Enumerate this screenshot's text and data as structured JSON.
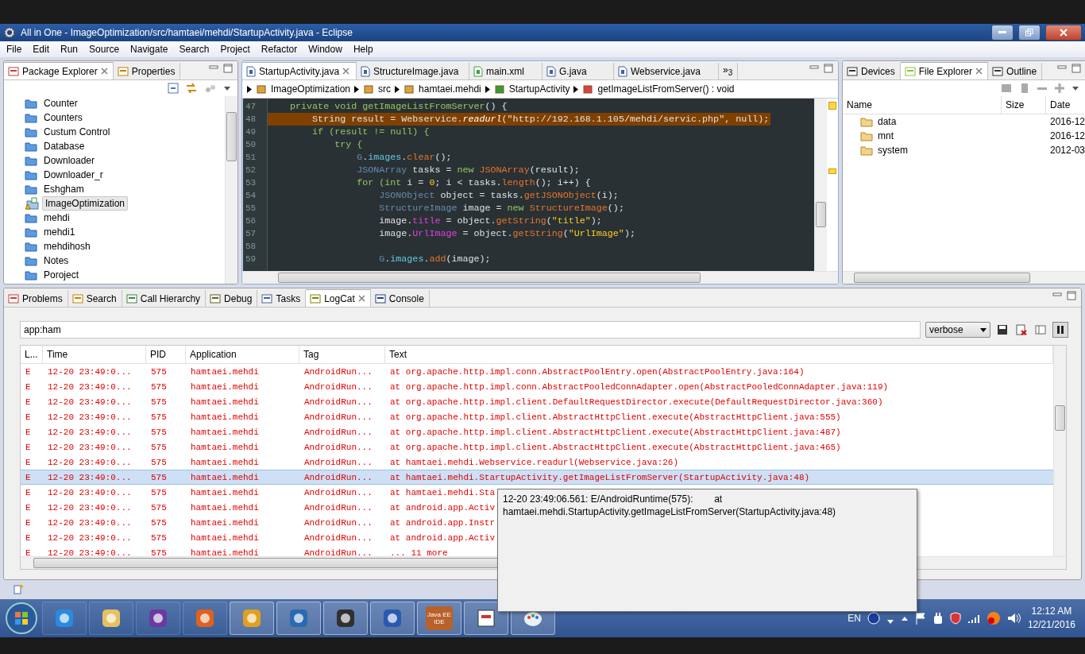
{
  "window": {
    "title": "All in One - ImageOptimization/src/hamtaei/mehdi/StartupActivity.java - Eclipse"
  },
  "menu": [
    "File",
    "Edit",
    "Run",
    "Source",
    "Navigate",
    "Search",
    "Project",
    "Refactor",
    "Window",
    "Help"
  ],
  "package_explorer": {
    "tabs": [
      {
        "label": "Package Explorer",
        "selected": true
      },
      {
        "label": "Properties",
        "selected": false
      }
    ],
    "items": [
      {
        "label": "Counter",
        "kind": "closed",
        "selected": false
      },
      {
        "label": "Counters",
        "kind": "closed",
        "selected": false
      },
      {
        "label": "Custum Control",
        "kind": "closed",
        "selected": false
      },
      {
        "label": "Database",
        "kind": "closed",
        "selected": false
      },
      {
        "label": "Downloader",
        "kind": "closed",
        "selected": false
      },
      {
        "label": "Downloader_r",
        "kind": "closed",
        "selected": false
      },
      {
        "label": "Eshgham",
        "kind": "closed",
        "selected": false
      },
      {
        "label": "ImageOptimization",
        "kind": "open",
        "selected": true
      },
      {
        "label": "mehdi",
        "kind": "closed",
        "selected": false
      },
      {
        "label": "mehdi1",
        "kind": "closed",
        "selected": false
      },
      {
        "label": "mehdihosh",
        "kind": "closed",
        "selected": false
      },
      {
        "label": "Notes",
        "kind": "closed",
        "selected": false
      },
      {
        "label": "Poroject",
        "kind": "closed",
        "selected": false
      }
    ]
  },
  "editor": {
    "tabs": [
      {
        "label": "StartupActivity.java",
        "selected": true
      },
      {
        "label": "StructureImage.java",
        "selected": false
      },
      {
        "label": "main.xml",
        "selected": false
      },
      {
        "label": "G.java",
        "selected": false
      },
      {
        "label": "Webservice.java",
        "selected": false
      }
    ],
    "overflow": "»$_{3}$",
    "breadcrumb": [
      "ImageOptimization",
      "src",
      "hamtaei.mehdi",
      "StartupActivity",
      "getImageListFromServer() : void"
    ],
    "lines": [
      {
        "number": "47",
        "highlighted": false,
        "tokens": [
          {
            "kind": "kw",
            "text": "    private void getImageListFromServer"
          },
          {
            "kind": "plain",
            "text": "() {"
          }
        ]
      },
      {
        "number": "48",
        "highlighted": true,
        "tokens": [
          {
            "kind": "plain",
            "text": "        String result = Webservice."
          },
          {
            "kind": "italic",
            "text": "readurl"
          },
          {
            "kind": "plain",
            "text": "(\"http://192.168.1.105/mehdi/servic.php\", null);"
          }
        ]
      },
      {
        "number": "49",
        "highlighted": false,
        "tokens": [
          {
            "kind": "kw",
            "text": "        if (result != null) {"
          }
        ]
      },
      {
        "number": "50",
        "highlighted": false,
        "tokens": [
          {
            "kind": "kw",
            "text": "            try {"
          }
        ]
      },
      {
        "number": "51",
        "highlighted": false,
        "tokens": [
          {
            "kind": "type",
            "text": "                G"
          },
          {
            "kind": "plain",
            "text": "."
          },
          {
            "kind": "field",
            "text": "images"
          },
          {
            "kind": "plain",
            "text": "."
          },
          {
            "kind": "method",
            "text": "clear"
          },
          {
            "kind": "plain",
            "text": "();"
          }
        ]
      },
      {
        "number": "52",
        "highlighted": false,
        "tokens": [
          {
            "kind": "type",
            "text": "                JSONArray"
          },
          {
            "kind": "plain",
            "text": " tasks = "
          },
          {
            "kind": "kw",
            "text": "new"
          },
          {
            "kind": "method",
            "text": " JSONArray"
          },
          {
            "kind": "plain",
            "text": "(result);"
          }
        ]
      },
      {
        "number": "53",
        "highlighted": false,
        "tokens": [
          {
            "kind": "kw",
            "text": "                for (int"
          },
          {
            "kind": "plain",
            "text": " i = "
          },
          {
            "kind": "num",
            "text": "0"
          },
          {
            "kind": "plain",
            "text": "; i < tasks."
          },
          {
            "kind": "method",
            "text": "length"
          },
          {
            "kind": "plain",
            "text": "(); i++) {"
          }
        ]
      },
      {
        "number": "54",
        "highlighted": false,
        "tokens": [
          {
            "kind": "type",
            "text": "                    JSONObject"
          },
          {
            "kind": "plain",
            "text": " object = tasks."
          },
          {
            "kind": "method",
            "text": "getJSONObject"
          },
          {
            "kind": "plain",
            "text": "(i);"
          }
        ]
      },
      {
        "number": "55",
        "highlighted": false,
        "tokens": [
          {
            "kind": "type",
            "text": "                    StructureImage"
          },
          {
            "kind": "plain",
            "text": " image = "
          },
          {
            "kind": "kw",
            "text": "new"
          },
          {
            "kind": "method",
            "text": " StructureImage"
          },
          {
            "kind": "plain",
            "text": "();"
          }
        ]
      },
      {
        "number": "56",
        "highlighted": false,
        "tokens": [
          {
            "kind": "plain",
            "text": "                    image."
          },
          {
            "kind": "member",
            "text": "title"
          },
          {
            "kind": "plain",
            "text": " = object."
          },
          {
            "kind": "method",
            "text": "getString"
          },
          {
            "kind": "plain",
            "text": "("
          },
          {
            "kind": "string",
            "text": "\"title\""
          },
          {
            "kind": "plain",
            "text": ");"
          }
        ]
      },
      {
        "number": "57",
        "highlighted": false,
        "tokens": [
          {
            "kind": "plain",
            "text": "                    image."
          },
          {
            "kind": "member",
            "text": "UrlImage"
          },
          {
            "kind": "plain",
            "text": " = object."
          },
          {
            "kind": "method",
            "text": "getString"
          },
          {
            "kind": "plain",
            "text": "("
          },
          {
            "kind": "string",
            "text": "\"UrlImage\""
          },
          {
            "kind": "plain",
            "text": ");"
          }
        ]
      },
      {
        "number": "58"
      },
      {
        "number": "59",
        "highlighted": false,
        "tokens": [
          {
            "kind": "type",
            "text": "                    G"
          },
          {
            "kind": "plain",
            "text": "."
          },
          {
            "kind": "field",
            "text": "images"
          },
          {
            "kind": "plain",
            "text": "."
          },
          {
            "kind": "method",
            "text": "add"
          },
          {
            "kind": "plain",
            "text": "(image);"
          }
        ]
      }
    ]
  },
  "file_explorer": {
    "tabs": [
      {
        "label": "Devices",
        "selected": false
      },
      {
        "label": "File Explorer",
        "selected": true
      },
      {
        "label": "Outline",
        "selected": false
      }
    ],
    "columns": [
      "Name",
      "Size",
      "Date"
    ],
    "rows": [
      {
        "name": "data",
        "date": "2016-12"
      },
      {
        "name": "mnt",
        "date": "2016-12"
      },
      {
        "name": "system",
        "date": "2012-03"
      }
    ]
  },
  "bottom": {
    "tabs": [
      {
        "label": "Problems",
        "selected": false
      },
      {
        "label": "Search",
        "selected": false
      },
      {
        "label": "Call Hierarchy",
        "selected": false
      },
      {
        "label": "Debug",
        "selected": false
      },
      {
        "label": "Tasks",
        "selected": false
      },
      {
        "label": "LogCat",
        "selected": true
      },
      {
        "label": "Console",
        "selected": false
      }
    ],
    "filter": "app:ham",
    "log_level": "verbose",
    "columns": [
      "L...",
      "Time",
      "PID",
      "Application",
      "Tag",
      "Text"
    ],
    "rows": [
      {
        "level": "E",
        "time": "12-20 23:49:0...",
        "pid": "575",
        "app": "hamtaei.mehdi",
        "tag": "AndroidRun...",
        "text": "at org.apache.http.impl.conn.AbstractPoolEntry.open(AbstractPoolEntry.java:164)",
        "selected": false
      },
      {
        "level": "E",
        "time": "12-20 23:49:0...",
        "pid": "575",
        "app": "hamtaei.mehdi",
        "tag": "AndroidRun...",
        "text": "at org.apache.http.impl.conn.AbstractPooledConnAdapter.open(AbstractPooledConnAdapter.java:119)",
        "selected": false
      },
      {
        "level": "E",
        "time": "12-20 23:49:0...",
        "pid": "575",
        "app": "hamtaei.mehdi",
        "tag": "AndroidRun...",
        "text": "at org.apache.http.impl.client.DefaultRequestDirector.execute(DefaultRequestDirector.java:360)",
        "selected": false
      },
      {
        "level": "E",
        "time": "12-20 23:49:0...",
        "pid": "575",
        "app": "hamtaei.mehdi",
        "tag": "AndroidRun...",
        "text": "at org.apache.http.impl.client.AbstractHttpClient.execute(AbstractHttpClient.java:555)",
        "selected": false
      },
      {
        "level": "E",
        "time": "12-20 23:49:0...",
        "pid": "575",
        "app": "hamtaei.mehdi",
        "tag": "AndroidRun...",
        "text": "at org.apache.http.impl.client.AbstractHttpClient.execute(AbstractHttpClient.java:487)",
        "selected": false
      },
      {
        "level": "E",
        "time": "12-20 23:49:0...",
        "pid": "575",
        "app": "hamtaei.mehdi",
        "tag": "AndroidRun...",
        "text": "at org.apache.http.impl.client.AbstractHttpClient.execute(AbstractHttpClient.java:465)",
        "selected": false
      },
      {
        "level": "E",
        "time": "12-20 23:49:0...",
        "pid": "575",
        "app": "hamtaei.mehdi",
        "tag": "AndroidRun...",
        "text": "at hamtaei.mehdi.Webservice.readurl(Webservice.java:26)",
        "selected": false
      },
      {
        "level": "E",
        "time": "12-20 23:49:0...",
        "pid": "575",
        "app": "hamtaei.mehdi",
        "tag": "AndroidRun...",
        "text": "at hamtaei.mehdi.StartupActivity.getImageListFromServer(StartupActivity.java:48)",
        "selected": true
      },
      {
        "level": "E",
        "time": "12-20 23:49:0...",
        "pid": "575",
        "app": "hamtaei.mehdi",
        "tag": "AndroidRun...",
        "text": "at hamtaei.mehdi.Sta",
        "selected": false
      },
      {
        "level": "E",
        "time": "12-20 23:49:0...",
        "pid": "575",
        "app": "hamtaei.mehdi",
        "tag": "AndroidRun...",
        "text": "at android.app.Activ",
        "selected": false
      },
      {
        "level": "E",
        "time": "12-20 23:49:0...",
        "pid": "575",
        "app": "hamtaei.mehdi",
        "tag": "AndroidRun...",
        "text": "at android.app.Instr",
        "selected": false
      },
      {
        "level": "E",
        "time": "12-20 23:49:0...",
        "pid": "575",
        "app": "hamtaei.mehdi",
        "tag": "AndroidRun...",
        "text": "at android.app.Activ",
        "selected": false
      },
      {
        "level": "E",
        "time": "12-20 23:49:0...",
        "pid": "575",
        "app": "hamtaei.mehdi",
        "tag": "AndroidRun...",
        "text": "... 11 more",
        "selected": false
      }
    ]
  },
  "tooltip": {
    "lines": [
      "12-20 23:49:06.561: E/AndroidRuntime(575):        at",
      "hamtaei.mehdi.StartupActivity.getImageListFromServer(StartupActivity.java:48)"
    ]
  },
  "taskbar": {
    "badge": "Java EE IDE",
    "language": "EN",
    "time": "12:12 AM",
    "date": "12/21/2016"
  }
}
